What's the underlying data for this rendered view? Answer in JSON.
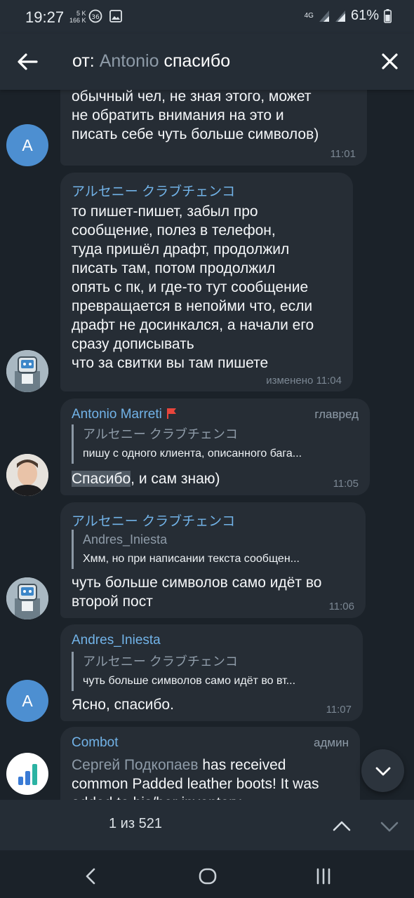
{
  "status_bar": {
    "time": "19:27",
    "speed_up": "5 K",
    "speed_down": "166 K",
    "network": "4G",
    "battery": "61%"
  },
  "toolbar": {
    "prefix": "от:",
    "name": "Antonio",
    "query": "спасибо"
  },
  "messages": [
    {
      "avatar_letter": "A",
      "lines": [
        "обычный чел, не зная этого, может",
        "не обратить внимания на это и",
        "писать себе чуть больше символов)"
      ],
      "time": "11:01"
    },
    {
      "sender": "アルセニー クラブチェンコ",
      "lines": [
        "то пишет-пишет, забыл про",
        "сообщение, полез в телефон,",
        "туда пришёл драфт, продолжил",
        "писать там, потом продолжил",
        "опять с пк, и где-то тут сообщение",
        "превращается в непойми что, если",
        "драфт не досинкался, а начали его",
        "сразу дописывать",
        "что за свитки вы там пишете"
      ],
      "time": "изменено 11:04"
    },
    {
      "sender": "Antonio Marreti",
      "admin_title": "главред",
      "reply_author": "アルセニー クラブチェンコ",
      "reply_text": "пишу с одного клиента, описанного бага...",
      "text_highlight": "Спасибо",
      "text_rest": ", и сам знаю)",
      "time": "11:05"
    },
    {
      "sender": "アルセニー クラブチェンコ",
      "reply_author": "Andres_Iniesta",
      "reply_text": "Хмм, но при написании текста сообщен...",
      "lines": [
        "чуть больше символов само идёт во",
        "второй пост"
      ],
      "time": "11:06"
    },
    {
      "sender": "Andres_Iniesta",
      "avatar_letter": "A",
      "reply_author": "アルセニー クラブチェンコ",
      "reply_text": "чуть больше символов само идёт во вт...",
      "text": "Ясно, спасибо.",
      "time": "11:07"
    },
    {
      "sender": "Combot",
      "admin_title": "админ",
      "link_name": "Сергей Подкопаев",
      "line1_rest": " has received",
      "line2": "common Padded leather boots! It was",
      "line3": "added to his/her inventory."
    }
  ],
  "search_nav": {
    "counter": "1 из 521"
  }
}
